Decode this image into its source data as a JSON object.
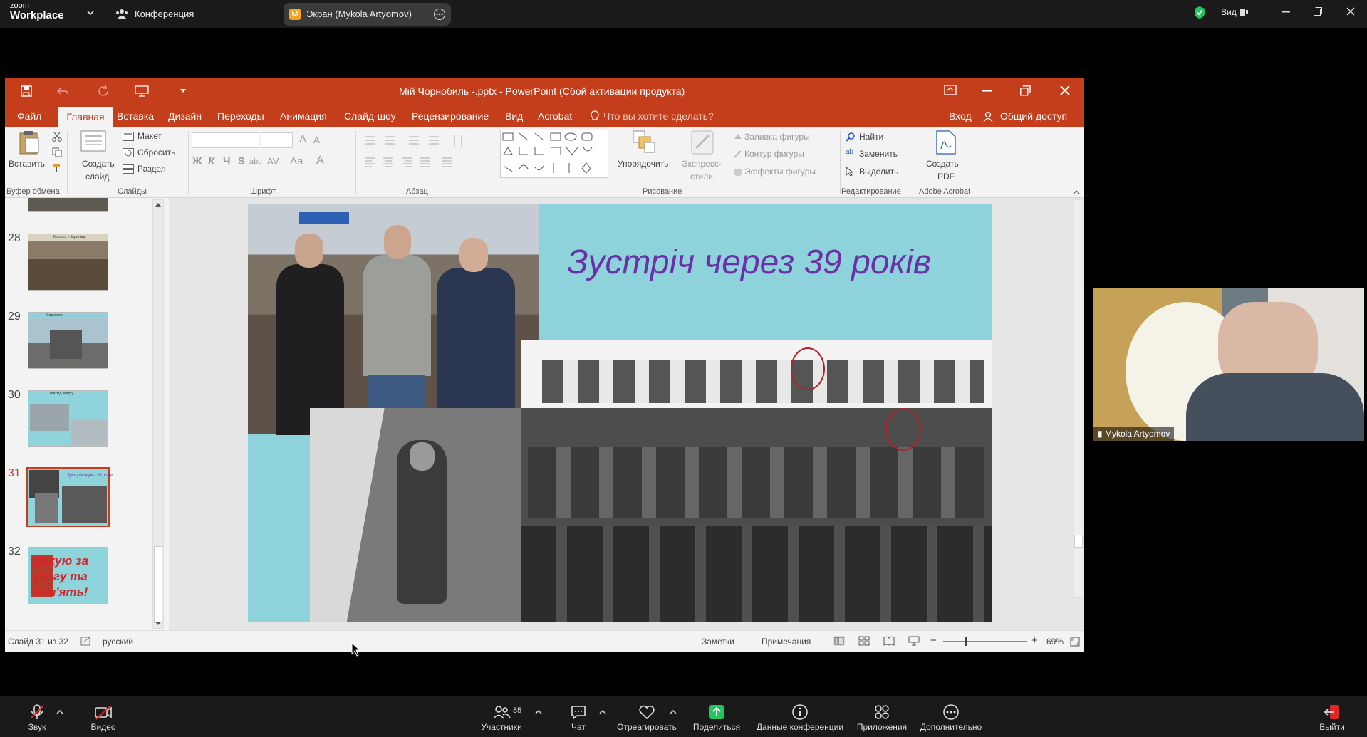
{
  "zoom": {
    "logo_top": "zoom",
    "logo_bottom": "Workplace",
    "conference_label": "Конференция",
    "share_badge": "M",
    "share_label": "Экран (Mykola Artyomov)",
    "view_label": "Вид",
    "participant_count": "85",
    "bottom": {
      "mute": "Звук",
      "video": "Видео",
      "participants": "Участники",
      "chat": "Чат",
      "react": "Отреагировать",
      "share": "Поделиться",
      "meeting_info": "Данные конференции",
      "apps": "Приложения",
      "more": "Дополнительно",
      "leave": "Выйти"
    },
    "video_name": "Mykola Artyomov",
    "colors": {
      "share_green": "#22c55e",
      "leave_red": "#e02828",
      "accent_orange": "#f0a52a"
    }
  },
  "ppt": {
    "title": "Мій Чорнобиль -.pptx - PowerPoint (Сбой активации продукта)",
    "tabs": [
      "Файл",
      "Главная",
      "Вставка",
      "Дизайн",
      "Переходы",
      "Анимация",
      "Слайд-шоу",
      "Рецензирование",
      "Вид",
      "Acrobat"
    ],
    "tell_me": "Что вы хотите сделать?",
    "login": "Вход",
    "share": "Общий доступ",
    "ribbon": {
      "paste": "Вставить",
      "clipboard_group": "Буфер обмена",
      "new_slide_1": "Создать",
      "new_slide_2": "слайд",
      "layout": "Макет",
      "reset": "Сбросить",
      "section": "Раздел",
      "slides_group": "Слайды",
      "font_group": "Шрифт",
      "paragraph_group": "Абзац",
      "arrange": "Упорядочить",
      "quick_styles_1": "Экспресс-",
      "quick_styles_2": "стили",
      "shape_fill": "Заливка фигуры",
      "shape_outline": "Контур фигуры",
      "shape_effects": "Эффекты фигуры",
      "drawing_group": "Рисование",
      "find": "Найти",
      "replace": "Заменить",
      "select": "Выделить",
      "editing_group": "Редактирование",
      "create_pdf_1": "Создать",
      "create_pdf_2": "PDF",
      "acrobat_group": "Adobe Acrobat",
      "font_buttons": {
        "bold": "Ж",
        "italic": "К",
        "underline": "Ч",
        "strike": "S",
        "shadow": "abc",
        "spacing": "AV",
        "case": "Aa",
        "color": "A"
      }
    },
    "thumbnails": [
      {
        "num": "28",
        "caption": "Колгосп у Кирилівці"
      },
      {
        "num": "29",
        "caption": "Саркофаг"
      },
      {
        "num": "30",
        "caption": "Вигляд зверху"
      },
      {
        "num": "31",
        "caption": "Зустріч через 39 років"
      },
      {
        "num": "32",
        "caption": "Дякую за увагу та пам'ять!"
      }
    ],
    "slide_title": "Зустріч через 39 років",
    "status": {
      "slide": "Слайд 31 из 32",
      "language": "русский",
      "notes": "Заметки",
      "comments": "Примечания",
      "zoom": "69%"
    }
  }
}
